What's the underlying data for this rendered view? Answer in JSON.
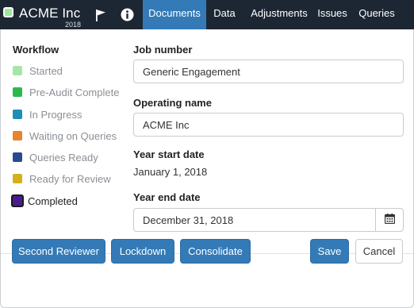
{
  "header": {
    "company_name": "ACME Inc",
    "year": "2018",
    "icons": [
      "flag-icon",
      "info-icon"
    ],
    "tabs": [
      {
        "label": "Documents",
        "active": true
      },
      {
        "label": "Data",
        "active": false
      },
      {
        "label": "Adjustments",
        "active": false
      },
      {
        "label": "Issues",
        "active": false
      },
      {
        "label": "Queries",
        "active": false
      }
    ],
    "colors": {
      "bar": "#1d2733",
      "active_tab": "#337ab7",
      "brand_square": "#9ee89e"
    }
  },
  "workflow": {
    "title": "Workflow",
    "current": "Completed",
    "items": [
      {
        "label": "Started",
        "color": "#a8e6a8"
      },
      {
        "label": "Pre-Audit Complete",
        "color": "#2db84d"
      },
      {
        "label": "In Progress",
        "color": "#1d8fb5"
      },
      {
        "label": "Waiting on Queries",
        "color": "#e8832e"
      },
      {
        "label": "Queries Ready",
        "color": "#2a4a8f"
      },
      {
        "label": "Ready for Review",
        "color": "#d4b11c"
      },
      {
        "label": "Completed",
        "color": "#4b1c8f"
      }
    ]
  },
  "form": {
    "job_number_label": "Job number",
    "job_number_value": "Generic Engagement",
    "operating_name_label": "Operating name",
    "operating_name_value": "ACME Inc",
    "year_start_label": "Year start date",
    "year_start_value": "January 1, 2018",
    "year_end_label": "Year end date",
    "year_end_value": "December 31, 2018",
    "calendar_icon": "calendar-icon"
  },
  "footer": {
    "second_reviewer_label": "Second Reviewer",
    "lockdown_label": "Lockdown",
    "consolidate_label": "Consolidate",
    "save_label": "Save",
    "cancel_label": "Cancel"
  }
}
